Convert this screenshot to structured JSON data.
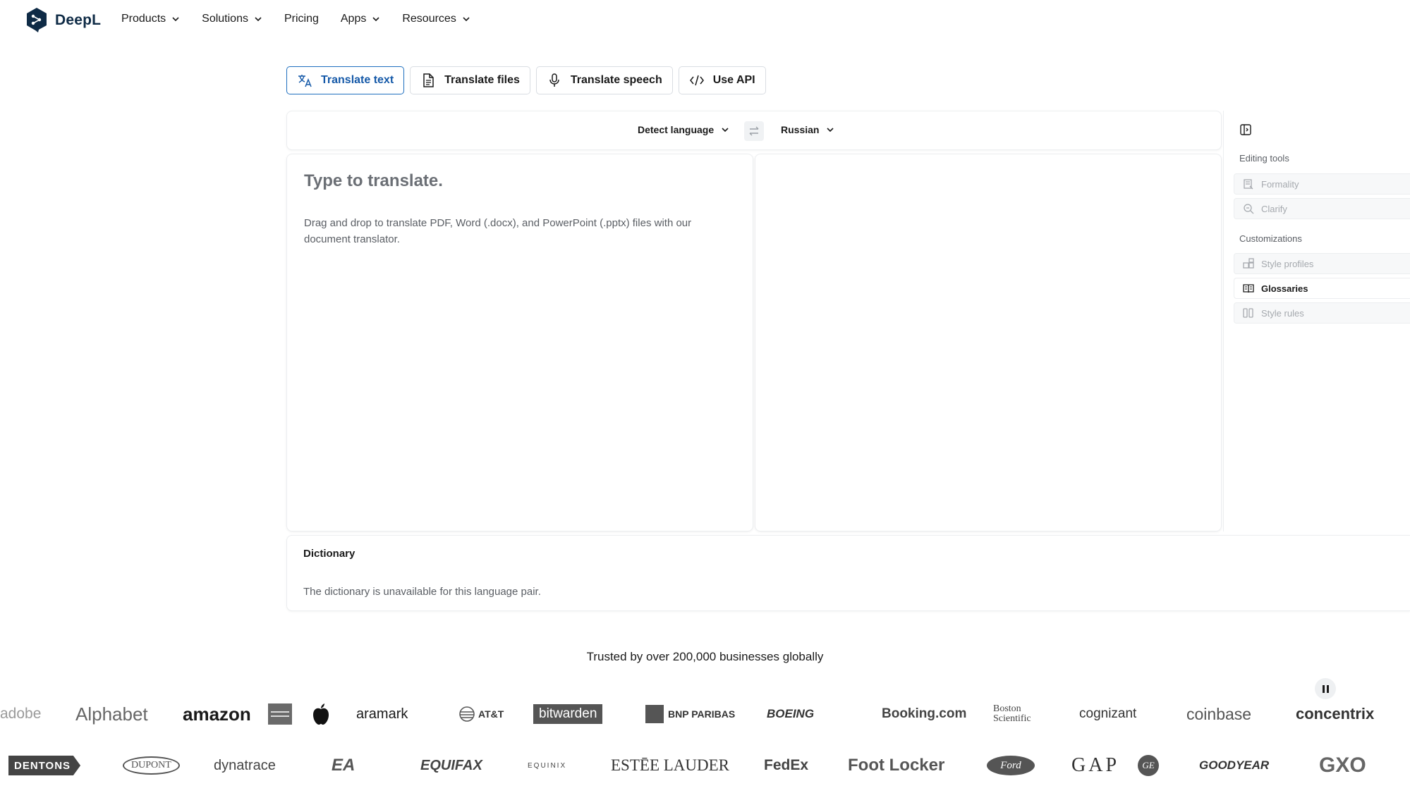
{
  "brand": {
    "name": "DeepL",
    "color": "#0f2b46"
  },
  "nav": {
    "items": [
      {
        "label": "Products",
        "dropdown": true
      },
      {
        "label": "Solutions",
        "dropdown": true
      },
      {
        "label": "Pricing",
        "dropdown": false
      },
      {
        "label": "Apps",
        "dropdown": true
      },
      {
        "label": "Resources",
        "dropdown": true
      }
    ]
  },
  "modes": [
    {
      "label": "Translate text",
      "icon": "translate-icon",
      "active": true
    },
    {
      "label": "Translate files",
      "icon": "file-icon",
      "active": false
    },
    {
      "label": "Translate speech",
      "icon": "microphone-icon",
      "active": false
    },
    {
      "label": "Use API",
      "icon": "code-icon",
      "active": false
    }
  ],
  "languages": {
    "source": "Detect language",
    "target": "Russian"
  },
  "source_panel": {
    "placeholder": "Type to translate.",
    "hint": "Drag and drop to translate PDF, Word (.docx), and PowerPoint (.pptx) files with our document translator."
  },
  "sidebar": {
    "editing_tools_heading": "Editing tools",
    "editing_tools": [
      {
        "label": "Formality",
        "icon": "formality-icon",
        "enabled": false
      },
      {
        "label": "Clarify",
        "icon": "clarify-icon",
        "enabled": false
      }
    ],
    "customizations_heading": "Customizations",
    "customizations": [
      {
        "label": "Style profiles",
        "icon": "style-profiles-icon",
        "enabled": false
      },
      {
        "label": "Glossaries",
        "icon": "glossary-icon",
        "enabled": true
      },
      {
        "label": "Style rules",
        "icon": "style-rules-icon",
        "enabled": false
      }
    ]
  },
  "dictionary": {
    "title": "Dictionary",
    "message": "The dictionary is unavailable for this language pair."
  },
  "trusted": {
    "text": "Trusted by over 200,000 businesses globally",
    "row1": [
      "adobe",
      "Alphabet",
      "amazon",
      "American Express",
      "Apple",
      "aramark",
      "AT&T",
      "bitwarden",
      "BNP PARIBAS",
      "BOEING",
      "Booking.com",
      "Boston Scientific",
      "cognizant",
      "coinbase",
      "concentrix"
    ],
    "row2": [
      "DENTONS",
      "DUPONT",
      "dynatrace",
      "EA",
      "EQUIFAX",
      "EQUINIX",
      "ESTĒE LAUDER",
      "FedEx",
      "Foot Locker",
      "Ford",
      "GAP",
      "GE",
      "GOODYEAR",
      "GXO"
    ]
  }
}
